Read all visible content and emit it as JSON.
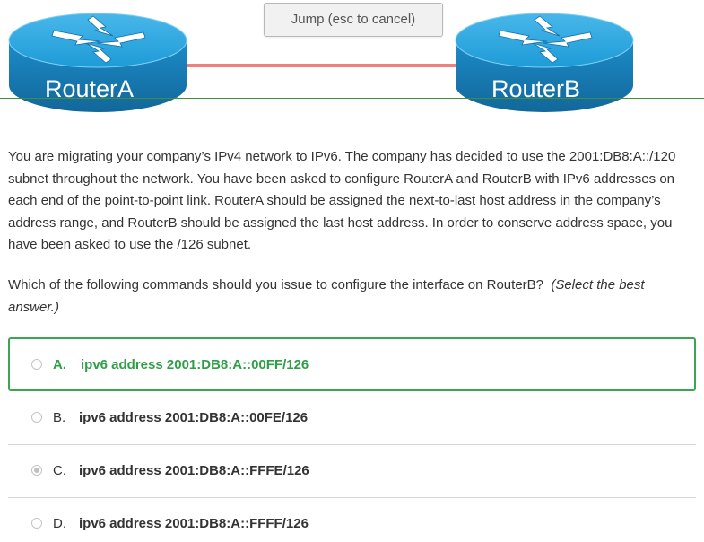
{
  "diagram": {
    "router_a_label": "RouterA",
    "router_b_label": "RouterB",
    "link_color": "#f08080",
    "router_top_color": "#1e9bd7",
    "router_side_color": "#1a7fb8",
    "router_icon": "router-arrows-icon"
  },
  "jump_box": {
    "text": "Jump (esc to cancel)"
  },
  "question": {
    "text": "You are migrating your company’s IPv4 network to IPv6. The company has decided to use the 2001:DB8:A::/120 subnet throughout the network. You have been asked to configure RouterA and RouterB with IPv6 addresses on each end of the point-to-point link. RouterA should be assigned the next-to-last host address in the company’s address range, and RouterB should be assigned the last host address. In order to conserve address space, you have been asked to use the /126 subnet.",
    "prompt": "Which of the following commands should you issue to configure the interface on RouterB?",
    "hint": "(Select the best answer.)"
  },
  "options": [
    {
      "letter": "A.",
      "command": "ipv6 address 2001:DB8:A::00FF/126",
      "state": "correct"
    },
    {
      "letter": "B.",
      "command": "ipv6 address 2001:DB8:A::00FE/126",
      "state": "unselected"
    },
    {
      "letter": "C.",
      "command": "ipv6 address 2001:DB8:A::FFFE/126",
      "state": "selected"
    },
    {
      "letter": "D.",
      "command": "ipv6 address 2001:DB8:A::FFFF/126",
      "state": "unselected"
    }
  ],
  "colors": {
    "correct_green": "#2f9e48",
    "text": "#333333"
  }
}
